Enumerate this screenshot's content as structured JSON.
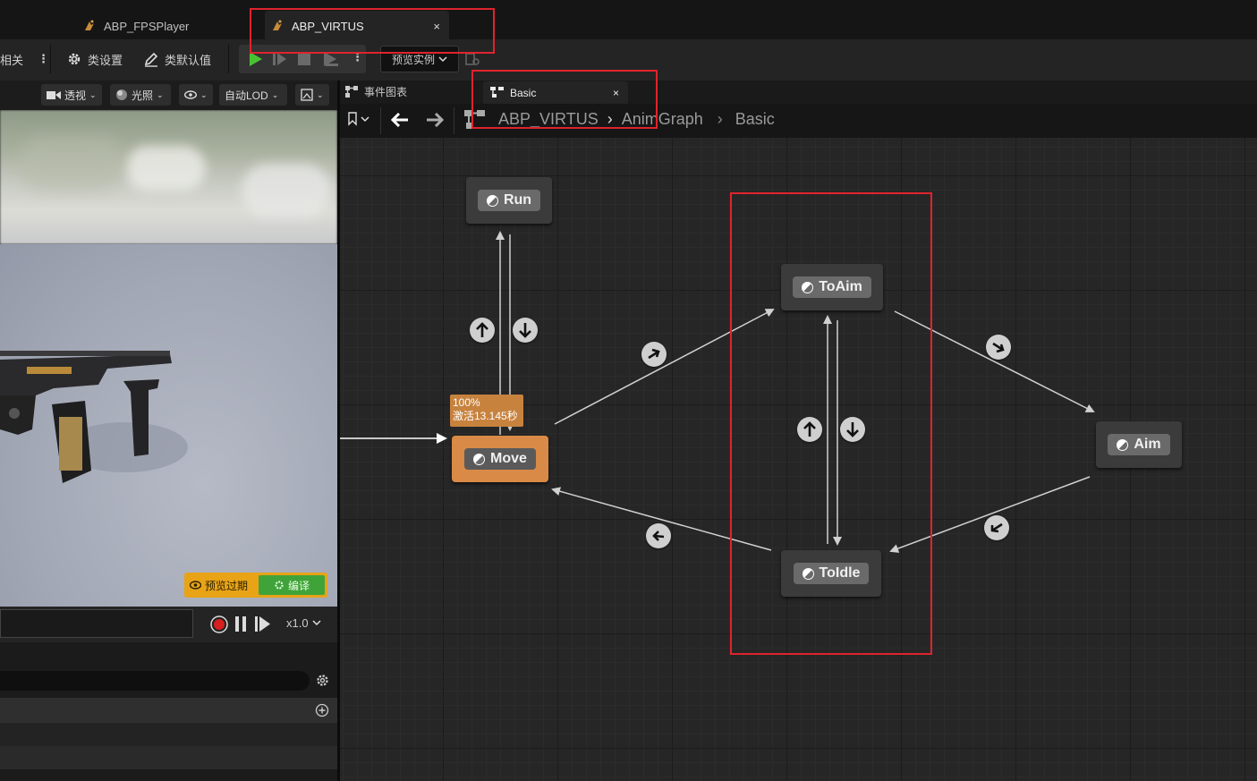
{
  "tabs": [
    {
      "label": "ABP_FPSPlayer"
    },
    {
      "label": "ABP_VIRTUS",
      "close": "×"
    }
  ],
  "toolbar": {
    "related": "相关",
    "class_settings": "类设置",
    "class_defaults": "类默认值",
    "preview_instance": "预览实例"
  },
  "viewport": {
    "perspective": "透视",
    "lighting": "光照",
    "auto_lod": "自动LOD",
    "preview_outdated": "预览过期",
    "compile": "编译",
    "speed": "x1.0"
  },
  "graph_tabs": [
    {
      "label": "事件图表"
    },
    {
      "label": "Basic",
      "close": "×"
    }
  ],
  "breadcrumb": {
    "root": "ABP_VIRTUS",
    "mid": "AnimGraph",
    "leaf": "Basic"
  },
  "states": {
    "run": "Run",
    "move": "Move",
    "to_aim": "ToAim",
    "aim": "Aim",
    "to_idle": "ToIdle"
  },
  "tooltip": {
    "weight": "100%",
    "active": "激活13.145秒"
  },
  "colors": {
    "active_state": "#d98a46",
    "highlight": "#e0232d",
    "play_green": "#49c232",
    "compile_green": "#3fa33a",
    "warning": "#e8a317"
  }
}
